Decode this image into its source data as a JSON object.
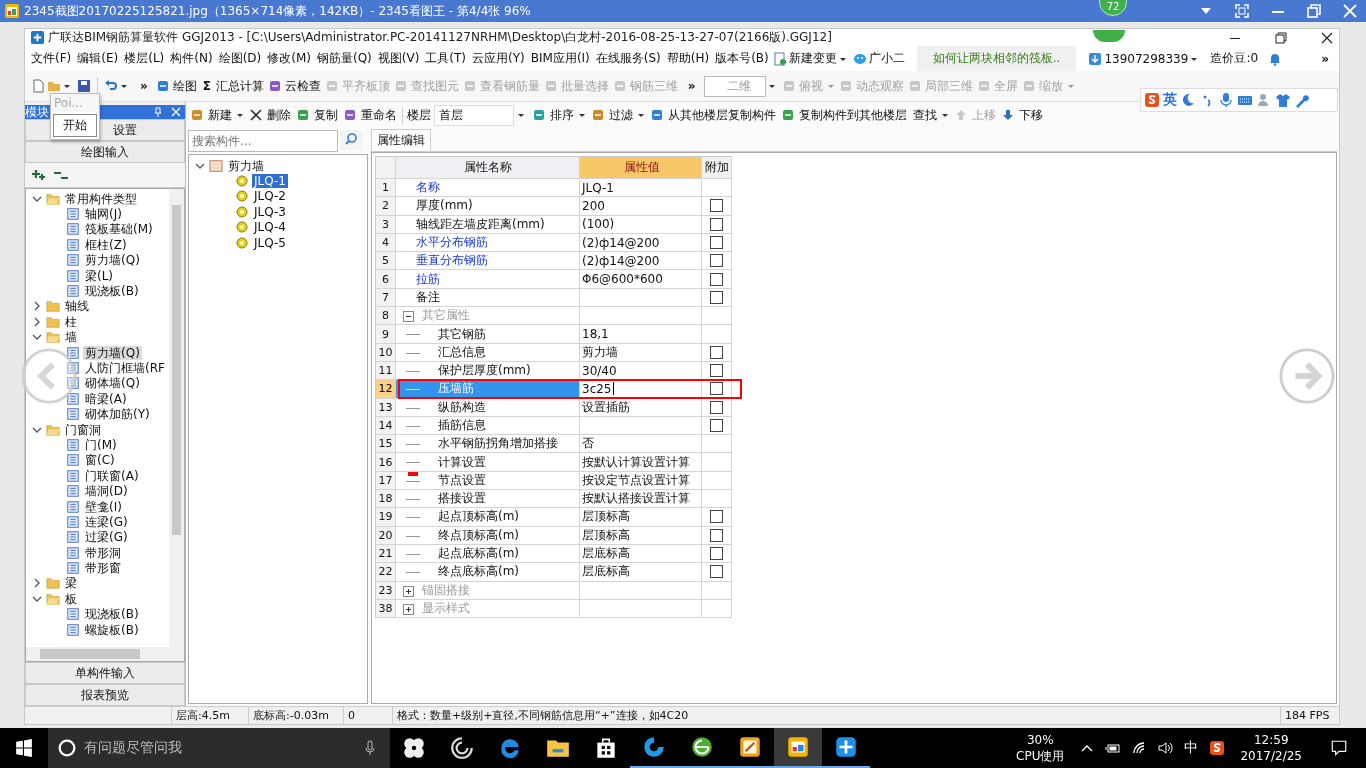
{
  "viewer": {
    "title": "2345截图20170225125821.jpg（1365×714像素，142KB）- 2345看图王 - 第4/4张 96%",
    "badge": "72"
  },
  "app": {
    "title": "广联达BIM钢筋算量软件 GGJ2013 - [C:\\Users\\Administrator.PC-20141127NRHM\\Desktop\\白龙村-2016-08-25-13-27-07(2166版).GGJ12]",
    "menu": [
      "文件(F)",
      "编辑(E)",
      "楼层(L)",
      "构件(N)",
      "绘图(D)",
      "修改(M)",
      "钢筋量(Q)",
      "视图(V)",
      "工具(T)",
      "云应用(Y)",
      "BIM应用(I)",
      "在线服务(S)",
      "帮助(H)",
      "版本号(B)"
    ],
    "new_change": "新建变更",
    "assistant": "广小二",
    "news": "如何让两块相邻的筏板..",
    "account": "13907298339",
    "beans": "造价豆:0",
    "more": "»",
    "toolbar": [
      {
        "kind": "more",
        "label": "»"
      },
      {
        "kind": "tool",
        "label": "绘图",
        "disabled": false,
        "dropdown": false
      },
      {
        "kind": "tool",
        "glyph": "Σ",
        "label": "汇总计算",
        "disabled": false,
        "dropdown": false
      },
      {
        "kind": "tool",
        "label": "云检查",
        "disabled": false,
        "dropdown": false
      },
      {
        "kind": "tool",
        "label": "平齐板顶",
        "disabled": true,
        "dropdown": false
      },
      {
        "kind": "tool",
        "label": "查找图元",
        "disabled": true,
        "dropdown": false
      },
      {
        "kind": "tool",
        "label": "查看钢筋量",
        "disabled": true,
        "dropdown": false
      },
      {
        "kind": "tool",
        "label": "批量选择",
        "disabled": true,
        "dropdown": false
      },
      {
        "kind": "tool",
        "label": "钢筋三维",
        "disabled": true,
        "dropdown": false
      },
      {
        "kind": "more",
        "label": "»"
      },
      {
        "kind": "select",
        "label": "二维",
        "disabled": true,
        "dropdown": true
      },
      {
        "kind": "tool",
        "label": "俯视",
        "disabled": true,
        "dropdown": true
      },
      {
        "kind": "tool",
        "label": "动态观察",
        "disabled": true,
        "dropdown": false
      },
      {
        "kind": "tool",
        "label": "局部三维",
        "disabled": true,
        "dropdown": false
      },
      {
        "kind": "tool",
        "label": "全屏",
        "disabled": true,
        "dropdown": false
      },
      {
        "kind": "tool",
        "label": "缩放",
        "disabled": true,
        "dropdown": true
      }
    ]
  },
  "ime": {
    "label": "英"
  },
  "popup": {
    "title": "Poi...",
    "item": "开始"
  },
  "nav": {
    "title": "模块",
    "top_buttons": [
      "设置",
      "绘图输入"
    ],
    "tree": [
      {
        "label": "常用构件类型",
        "expanded": true,
        "selected": false,
        "children": [
          {
            "label": "轴网(J)",
            "selected": false
          },
          {
            "label": "筏板基础(M)",
            "selected": false
          },
          {
            "label": "框柱(Z)",
            "selected": false
          },
          {
            "label": "剪力墙(Q)",
            "selected": false
          },
          {
            "label": "梁(L)",
            "selected": false
          },
          {
            "label": "现浇板(B)",
            "selected": false
          }
        ]
      },
      {
        "label": "轴线",
        "expanded": false,
        "selected": false
      },
      {
        "label": "柱",
        "expanded": false,
        "selected": false
      },
      {
        "label": "墙",
        "expanded": true,
        "selected": false,
        "children": [
          {
            "label": "剪力墙(Q)",
            "selected": true
          },
          {
            "label": "人防门框墙(RF",
            "selected": false
          },
          {
            "label": "砌体墙(Q)",
            "selected": false
          },
          {
            "label": "暗梁(A)",
            "selected": false
          },
          {
            "label": "砌体加筋(Y)",
            "selected": false
          }
        ]
      },
      {
        "label": "门窗洞",
        "expanded": true,
        "selected": false,
        "children": [
          {
            "label": "门(M)",
            "selected": false
          },
          {
            "label": "窗(C)",
            "selected": false
          },
          {
            "label": "门联窗(A)",
            "selected": false
          },
          {
            "label": "墙洞(D)",
            "selected": false
          },
          {
            "label": "壁龛(I)",
            "selected": false
          },
          {
            "label": "连梁(G)",
            "selected": false
          },
          {
            "label": "过梁(G)",
            "selected": false
          },
          {
            "label": "带形洞",
            "selected": false
          },
          {
            "label": "带形窗",
            "selected": false
          }
        ]
      },
      {
        "label": "梁",
        "expanded": false,
        "selected": false
      },
      {
        "label": "板",
        "expanded": true,
        "selected": false,
        "children": [
          {
            "label": "现浇板(B)",
            "selected": false
          },
          {
            "label": "螺旋板(B)",
            "selected": false
          }
        ]
      }
    ],
    "bottom_buttons": [
      "单构件输入",
      "报表预览"
    ]
  },
  "components": {
    "toolbar": [
      {
        "kind": "tool",
        "label": "新建",
        "disabled": false,
        "dropdown": true
      },
      {
        "kind": "delete",
        "label": "删除",
        "disabled": false,
        "dropdown": false
      },
      {
        "kind": "tool",
        "label": "复制",
        "disabled": false,
        "dropdown": false
      },
      {
        "kind": "tool",
        "label": "重命名",
        "disabled": false,
        "dropdown": false
      },
      {
        "kind": "floor",
        "label": "楼层",
        "value": "首层",
        "dropdown": true
      },
      {
        "kind": "tool",
        "label": "排序",
        "disabled": false,
        "dropdown": true
      },
      {
        "kind": "tool",
        "label": "过滤",
        "disabled": false,
        "dropdown": true
      },
      {
        "kind": "tool",
        "label": "从其他楼层复制构件",
        "disabled": false,
        "dropdown": false
      },
      {
        "kind": "tool",
        "label": "复制构件到其他楼层",
        "disabled": false,
        "dropdown": false
      },
      {
        "kind": "text",
        "label": "查找",
        "disabled": false,
        "dropdown": true
      },
      {
        "kind": "up",
        "label": "上移",
        "disabled": true,
        "dropdown": false
      },
      {
        "kind": "down",
        "label": "下移",
        "disabled": false,
        "dropdown": false
      }
    ],
    "search": {
      "placeholder": "搜索构件..."
    },
    "tree": [
      {
        "label": "剪力墙",
        "expanded": true,
        "selected": false,
        "children": [
          {
            "label": "JLQ-1",
            "selected": true
          },
          {
            "label": "JLQ-2",
            "selected": false
          },
          {
            "label": "JLQ-3",
            "selected": false
          },
          {
            "label": "JLQ-4",
            "selected": false
          },
          {
            "label": "JLQ-5",
            "selected": false
          }
        ]
      }
    ]
  },
  "properties": {
    "tab": "属性编辑",
    "columns": [
      "属性名称",
      "属性值",
      "附加"
    ],
    "rows": [
      {
        "num": "1",
        "kind": "prop",
        "name": "名称",
        "blue": true,
        "value": "JLQ-1",
        "selected": false
      },
      {
        "num": "2",
        "kind": "prop",
        "name": "厚度(mm)",
        "blue": false,
        "value": "200",
        "checkbox": {
          "checked": false
        },
        "selected": false
      },
      {
        "num": "3",
        "kind": "prop",
        "name": "轴线距左墙皮距离(mm)",
        "blue": false,
        "value": "(100)",
        "checkbox": {
          "checked": false
        },
        "selected": false
      },
      {
        "num": "4",
        "kind": "prop",
        "name": "水平分布钢筋",
        "blue": true,
        "value": "(2)ф14@200",
        "checkbox": {
          "checked": false
        },
        "selected": false
      },
      {
        "num": "5",
        "kind": "prop",
        "name": "垂直分布钢筋",
        "blue": true,
        "value": "(2)ф14@200",
        "checkbox": {
          "checked": false
        },
        "selected": false
      },
      {
        "num": "6",
        "kind": "prop",
        "name": "拉筋",
        "blue": true,
        "value": "Φ6@600*600",
        "checkbox": {
          "checked": false
        },
        "selected": false
      },
      {
        "num": "7",
        "kind": "prop",
        "name": "备注",
        "blue": false,
        "value": "",
        "checkbox": {
          "checked": false
        },
        "selected": false
      },
      {
        "num": "8",
        "kind": "group",
        "name": "其它属性",
        "expanded": true,
        "selected": false
      },
      {
        "num": "9",
        "kind": "child",
        "name": "其它钢筋",
        "value": "18,1",
        "selected": false
      },
      {
        "num": "10",
        "kind": "child",
        "name": "汇总信息",
        "value": "剪力墙",
        "checkbox": {
          "checked": false
        },
        "selected": false
      },
      {
        "num": "11",
        "kind": "child",
        "name": "保护层厚度(mm)",
        "value": "30/40",
        "checkbox": {
          "checked": false
        },
        "selected": false
      },
      {
        "num": "12",
        "kind": "child",
        "name": "压墙筋",
        "value": "3c25",
        "checkbox": {
          "checked": false
        },
        "selected": true,
        "highlighted": true
      },
      {
        "num": "13",
        "kind": "child",
        "name": "纵筋构造",
        "value": "设置插筋",
        "checkbox": {
          "checked": false
        },
        "selected": false
      },
      {
        "num": "14",
        "kind": "child",
        "name": "插筋信息",
        "value": "",
        "checkbox": {
          "checked": false
        },
        "selected": false
      },
      {
        "num": "15",
        "kind": "child",
        "name": "水平钢筋拐角增加搭接",
        "value": "否",
        "selected": false
      },
      {
        "num": "16",
        "kind": "child",
        "name": "计算设置",
        "value": "按默认计算设置计算",
        "selected": false
      },
      {
        "num": "17",
        "kind": "child",
        "name": "节点设置",
        "value": "按设定节点设置计算",
        "selected": false,
        "marked": true
      },
      {
        "num": "18",
        "kind": "child",
        "name": "搭接设置",
        "value": "按默认搭接设置计算",
        "selected": false
      },
      {
        "num": "19",
        "kind": "child",
        "name": "起点顶标高(m)",
        "value": "层顶标高",
        "checkbox": {
          "checked": false
        },
        "selected": false
      },
      {
        "num": "20",
        "kind": "child",
        "name": "终点顶标高(m)",
        "value": "层顶标高",
        "checkbox": {
          "checked": false
        },
        "selected": false
      },
      {
        "num": "21",
        "kind": "child",
        "name": "起点底标高(m)",
        "value": "层底标高",
        "checkbox": {
          "checked": false
        },
        "selected": false
      },
      {
        "num": "22",
        "kind": "child",
        "name": "终点底标高(m)",
        "value": "层底标高",
        "checkbox": {
          "checked": false
        },
        "selected": false
      },
      {
        "num": "23",
        "kind": "group",
        "name": "锚固搭接",
        "expanded": false,
        "selected": false
      },
      {
        "num": "38",
        "kind": "group",
        "name": "显示样式",
        "expanded": false,
        "selected": false
      }
    ]
  },
  "status": {
    "floor_height": "层高:4.5m",
    "base_elevation": "底标高:-0.03m",
    "count": "0",
    "hint": "格式：数量+级别+直径,不同钢筋信息用“+”连接，如4C20",
    "fps": "184 FPS"
  },
  "taskbar": {
    "search": {
      "placeholder": "有问题尽管问我"
    },
    "apps": [
      {
        "kind": "pinwheel",
        "running": false,
        "active": false
      },
      {
        "kind": "swirl",
        "running": false,
        "active": false
      },
      {
        "kind": "edge",
        "running": false,
        "active": false
      },
      {
        "kind": "folder",
        "running": false,
        "active": false
      },
      {
        "kind": "store",
        "running": false,
        "active": false
      },
      {
        "kind": "bluebird",
        "running": true,
        "active": false
      },
      {
        "kind": "globe",
        "running": true,
        "active": false
      },
      {
        "kind": "notepad",
        "running": true,
        "active": false
      },
      {
        "kind": "viewer",
        "running": true,
        "active": true
      },
      {
        "kind": "plus",
        "running": true,
        "active": false
      }
    ],
    "cpu_percent": "30%",
    "cpu_label": "CPU使用",
    "ime": "中",
    "time": "12:59",
    "date": "2017/2/25"
  }
}
